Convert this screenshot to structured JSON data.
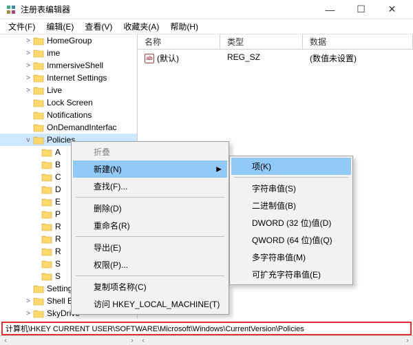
{
  "window": {
    "title": "注册表编辑器",
    "minimize": "—",
    "maximize": "☐",
    "close": "✕"
  },
  "menubar": {
    "file": "文件(F)",
    "edit": "编辑(E)",
    "view": "查看(V)",
    "favorites": "收藏夹(A)",
    "help": "帮助(H)"
  },
  "list_header": {
    "name": "名称",
    "type": "类型",
    "data": "数据"
  },
  "list_row": {
    "name": "(默认)",
    "type": "REG_SZ",
    "data": "(数值未设置)"
  },
  "tree": {
    "items": [
      {
        "label": "HomeGroup",
        "expander": ">"
      },
      {
        "label": "ime",
        "expander": ">"
      },
      {
        "label": "ImmersiveShell",
        "expander": ">"
      },
      {
        "label": "Internet Settings",
        "expander": ">"
      },
      {
        "label": "Live",
        "expander": ">"
      },
      {
        "label": "Lock Screen",
        "expander": ""
      },
      {
        "label": "Notifications",
        "expander": ""
      },
      {
        "label": "OnDemandInterfac",
        "expander": ""
      },
      {
        "label": "Policies",
        "expander": "v",
        "selected": true
      }
    ],
    "children": [
      "A",
      "B",
      "C",
      "D",
      "E",
      "P",
      "R",
      "R",
      "R",
      "S",
      "S"
    ],
    "after": [
      {
        "label": "SettingSync",
        "expander": ""
      },
      {
        "label": "Shell Extensions",
        "expander": ">"
      },
      {
        "label": "SkyDrive",
        "expander": ">"
      }
    ]
  },
  "context_menu": {
    "collapse": "折叠",
    "new": "新建(N)",
    "find": "查找(F)...",
    "delete": "删除(D)",
    "rename": "重命名(R)",
    "export": "导出(E)",
    "permissions": "权限(P)...",
    "copy_key": "复制项名称(C)",
    "goto": "访问 HKEY_LOCAL_MACHINE(T)"
  },
  "submenu": {
    "key": "项(K)",
    "string": "字符串值(S)",
    "binary": "二进制值(B)",
    "dword": "DWORD (32 位)值(D)",
    "qword": "QWORD (64 位)值(Q)",
    "multi": "多字符串值(M)",
    "expand": "可扩充字符串值(E)"
  },
  "pathbar": "计算机\\HKEY CURRENT USER\\SOFTWARE\\Microsoft\\Windows\\CurrentVersion\\Policies"
}
